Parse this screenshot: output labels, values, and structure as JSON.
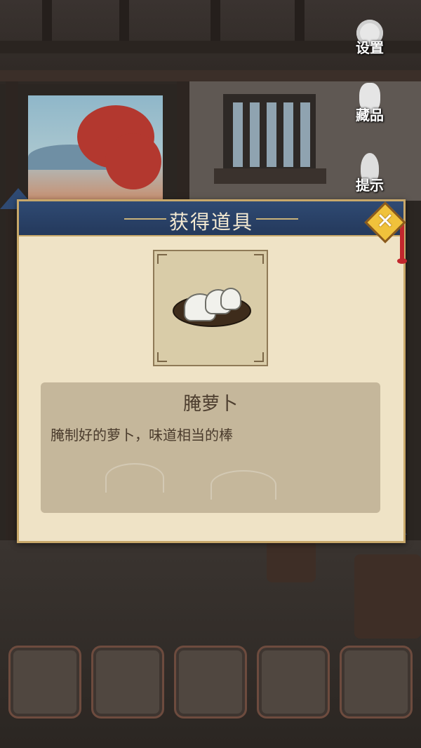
{
  "menu": {
    "settings_label": "设置",
    "collection_label": "藏品",
    "hint_label": "提示"
  },
  "dialog": {
    "title": "获得道具",
    "close_symbol": "✕",
    "item": {
      "name": "腌萝卜",
      "description": "腌制好的萝卜，味道相当的棒",
      "icon": "pickled-radish-icon"
    }
  },
  "inventory": {
    "slots": [
      "",
      "",
      "",
      "",
      ""
    ]
  },
  "colors": {
    "header_blue": "#2f4a73",
    "parchment": "#efe3c6",
    "gold": "#f0c23b"
  }
}
